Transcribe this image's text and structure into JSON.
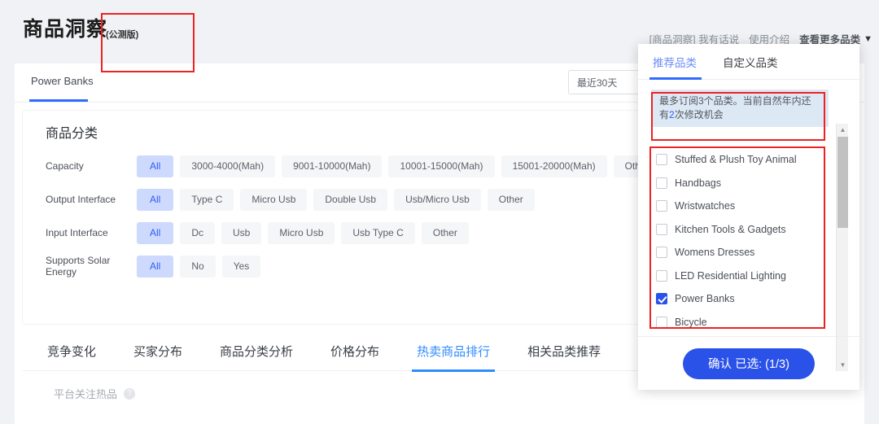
{
  "header": {
    "title": "商品洞察",
    "subtitle": "(公测版)",
    "nav": [
      {
        "label": "[商品洞察] 我有话说",
        "name": "nav-feedback"
      },
      {
        "label": "使用介绍",
        "name": "nav-intro"
      },
      {
        "label": "查看更多品类",
        "name": "nav-more-categories"
      }
    ],
    "caret": "▼"
  },
  "category_tab": {
    "label": "Power Banks"
  },
  "date_range": {
    "value": "最近30天"
  },
  "filter_card": {
    "title": "商品分类",
    "rows": [
      {
        "label": "Capacity",
        "options": [
          "All",
          "3000-4000(Mah)",
          "9001-10000(Mah)",
          "10001-15000(Mah)",
          "15001-20000(Mah)",
          "Other"
        ],
        "active": 0
      },
      {
        "label": "Output Interface",
        "options": [
          "All",
          "Type C",
          "Micro Usb",
          "Double Usb",
          "Usb/Micro Usb",
          "Other"
        ],
        "active": 0
      },
      {
        "label": "Input Interface",
        "options": [
          "All",
          "Dc",
          "Usb",
          "Micro Usb",
          "Usb Type C",
          "Other"
        ],
        "active": 0
      },
      {
        "label": "Supports Solar Energy",
        "options": [
          "All",
          "No",
          "Yes"
        ],
        "active": 0
      }
    ]
  },
  "bottom_tabs": {
    "items": [
      "竞争变化",
      "买家分布",
      "商品分类分析",
      "价格分布",
      "热卖商品排行",
      "相关品类推荐"
    ],
    "active": 4
  },
  "hot_section": {
    "label": "平台关注热品",
    "help": "?"
  },
  "dropdown": {
    "tabs": [
      {
        "label": "推荐品类",
        "active": true
      },
      {
        "label": "自定义品类",
        "active": false
      }
    ],
    "notice": {
      "part1": "最多订阅3个品类。当前自然年内还有",
      "highlight": "2",
      "part2": "次修改机会"
    },
    "items": [
      {
        "label": "Stuffed & Plush Toy Animal",
        "checked": false
      },
      {
        "label": "Handbags",
        "checked": false
      },
      {
        "label": "Wristwatches",
        "checked": false
      },
      {
        "label": "Kitchen Tools & Gadgets",
        "checked": false
      },
      {
        "label": "Womens Dresses",
        "checked": false
      },
      {
        "label": "LED Residential Lighting",
        "checked": false
      },
      {
        "label": "Power Banks",
        "checked": true
      },
      {
        "label": "Bicycle",
        "checked": false
      }
    ],
    "scroll_up": "▲",
    "scroll_down": "▼",
    "confirm_label": "确认 已选: (1/3)"
  },
  "colors": {
    "accent_blue": "#2a52e8",
    "tab_blue": "#2f8bff",
    "chip_active_bg": "#cdd9fd",
    "annotation_red": "#ee2222",
    "notice_bg": "#dde8f5"
  }
}
